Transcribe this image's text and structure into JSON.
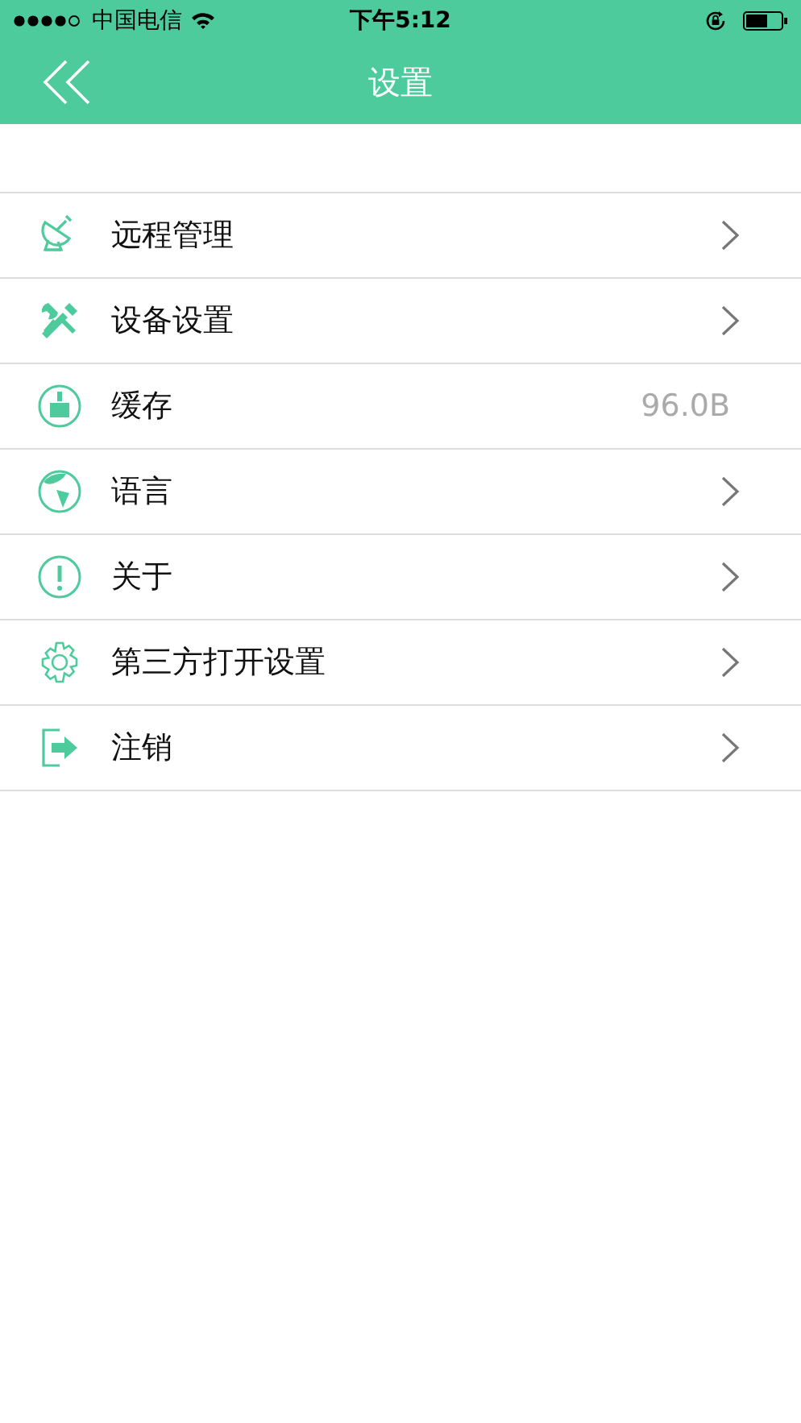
{
  "status_bar": {
    "carrier": "中国电信",
    "time": "下午5:12"
  },
  "nav": {
    "title": "设置"
  },
  "items": [
    {
      "label": "远程管理",
      "kind": "link"
    },
    {
      "label": "设备设置",
      "kind": "link"
    },
    {
      "label": "缓存",
      "kind": "value",
      "value": "96.0B"
    },
    {
      "label": "语言",
      "kind": "link"
    },
    {
      "label": "关于",
      "kind": "link"
    },
    {
      "label": "第三方打开设置",
      "kind": "link"
    },
    {
      "label": "注销",
      "kind": "link"
    }
  ]
}
